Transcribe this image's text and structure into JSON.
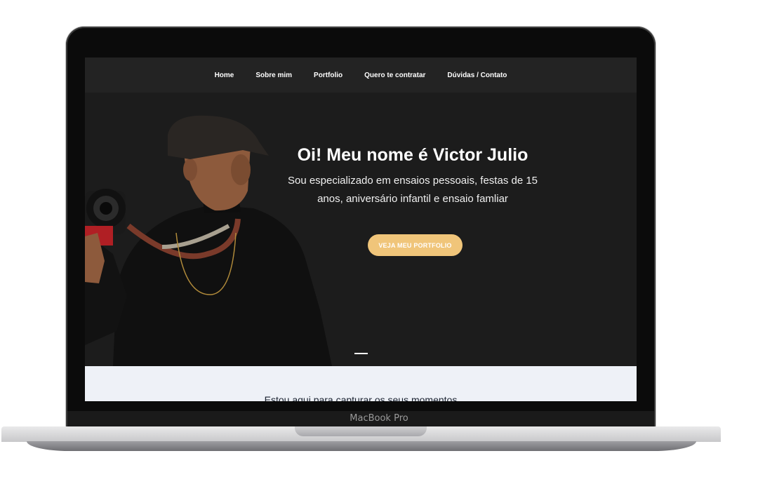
{
  "nav": {
    "items": [
      "Home",
      "Sobre mim",
      "Portfolio",
      "Quero te contratar",
      "Dúvidas / Contato"
    ]
  },
  "hero": {
    "title": "Oi! Meu nome é Victor Julio",
    "subtitle": "Sou especializado em ensaios pessoais, festas de 15 anos, aniversário infantil e ensaio famliar",
    "cta_label": "VEJA MEU PORTFOLIO"
  },
  "section2": {
    "heading": "Estou aqui para capturar os seus momentos"
  },
  "device": {
    "label": "MacBook Pro"
  },
  "colors": {
    "accent": "#f0c57a",
    "hero_bg": "#1c1c1c",
    "nav_bg": "#232323",
    "section_bg": "#eef1f7"
  }
}
